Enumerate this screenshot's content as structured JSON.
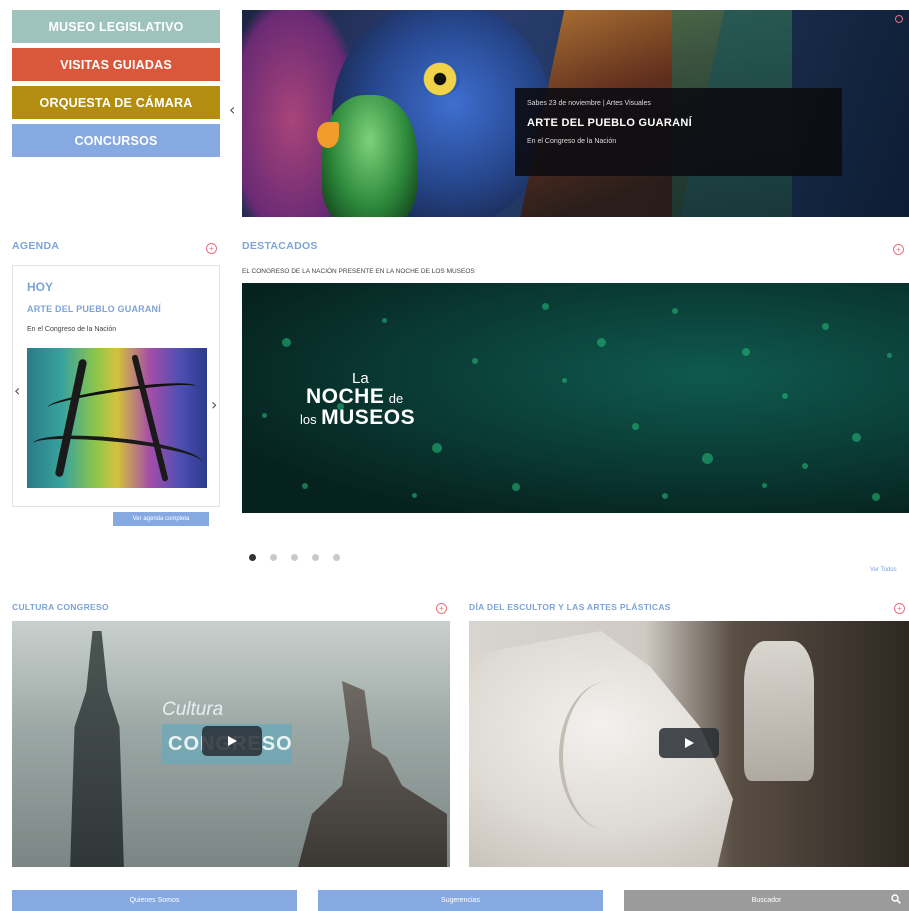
{
  "sidebar": {
    "items": [
      {
        "label": "MUSEO LEGISLATIVO"
      },
      {
        "label": "VISITAS GUIADAS"
      },
      {
        "label": "ORQUESTA DE CÁMARA"
      },
      {
        "label": "CONCURSOS"
      }
    ]
  },
  "hero": {
    "date": "Sabes 23 de noviembre | Artes Visuales",
    "title": "ARTE DEL PUEBLO GUARANÍ",
    "subtitle": "En el Congreso de la Nación"
  },
  "agenda": {
    "title": "AGENDA",
    "today": "HOY",
    "event_title": "ARTE DEL PUEBLO GUARANÍ",
    "event_subtitle": "En el Congreso de la Nación",
    "button": "Ver agenda completa"
  },
  "destacados": {
    "title": "DESTACADOS",
    "subtitle": "EL CONGRESO DE LA NACIÓN PRESENTE EN LA NOCHE DE LOS MUSEOS",
    "logo": {
      "la": "La",
      "noche": "NOCHE",
      "de": "de",
      "los": "los",
      "museos": "MUSEOS"
    },
    "carousel_count": 5,
    "carousel_active": 1,
    "ver_todos": "Ver Todos"
  },
  "videos": [
    {
      "title": "CULTURA CONGRESO",
      "overlay_top": "Cultura",
      "overlay_band": "CONGRESO"
    },
    {
      "title": "DÍA DEL ESCULTOR Y LAS ARTES PLÁSTICAS"
    }
  ],
  "bottom": {
    "btn1": "Quienes Somos",
    "btn2": "Sugerencias",
    "btn3": "Buscador"
  },
  "colors": {
    "accent_blue": "#86a9e2",
    "teal": "#9ec3bc",
    "orange": "#d9583b",
    "mustard": "#b38d0f",
    "pink_icon": "#e7717d"
  }
}
